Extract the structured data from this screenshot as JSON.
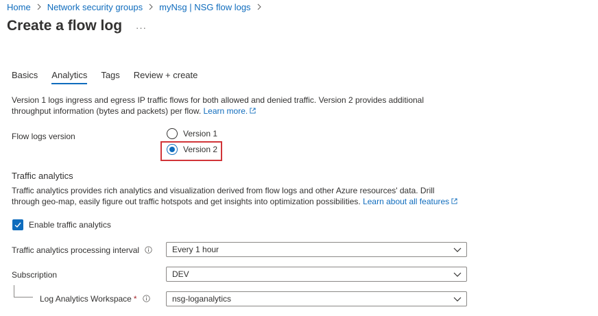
{
  "breadcrumb": {
    "items": [
      "Home",
      "Network security groups",
      "myNsg | NSG flow logs"
    ]
  },
  "page": {
    "title": "Create a flow log",
    "more_label": "···"
  },
  "tabs": [
    {
      "label": "Basics",
      "active": false
    },
    {
      "label": "Analytics",
      "active": true
    },
    {
      "label": "Tags",
      "active": false
    },
    {
      "label": "Review + create",
      "active": false
    }
  ],
  "intro": {
    "text": "Version 1 logs ingress and egress IP traffic flows for both allowed and denied traffic. Version 2 provides additional throughput information (bytes and packets) per flow.",
    "link": "Learn more."
  },
  "flow_logs_version": {
    "label": "Flow logs version",
    "options": [
      "Version 1",
      "Version 2"
    ],
    "selected": "Version 2"
  },
  "traffic_analytics": {
    "title": "Traffic analytics",
    "description": "Traffic analytics provides rich analytics and visualization derived from flow logs and other Azure resources' data. Drill through geo-map, easily figure out traffic hotspots and get insights into optimization possibilities.",
    "link": "Learn about all features",
    "enable_label": "Enable traffic analytics",
    "enabled": true
  },
  "fields": {
    "interval": {
      "label": "Traffic analytics processing interval",
      "value": "Every 1 hour"
    },
    "subscription": {
      "label": "Subscription",
      "value": "DEV"
    },
    "workspace": {
      "label": "Log Analytics Workspace",
      "required_mark": "*",
      "value": "nsg-loganalytics"
    }
  },
  "colors": {
    "accent": "#0f6cbd",
    "highlight_border": "#d13438"
  },
  "icons": {
    "chevron": "chevron-down-icon",
    "external": "external-link-icon",
    "info": "info-icon",
    "check": "checkmark-icon"
  }
}
